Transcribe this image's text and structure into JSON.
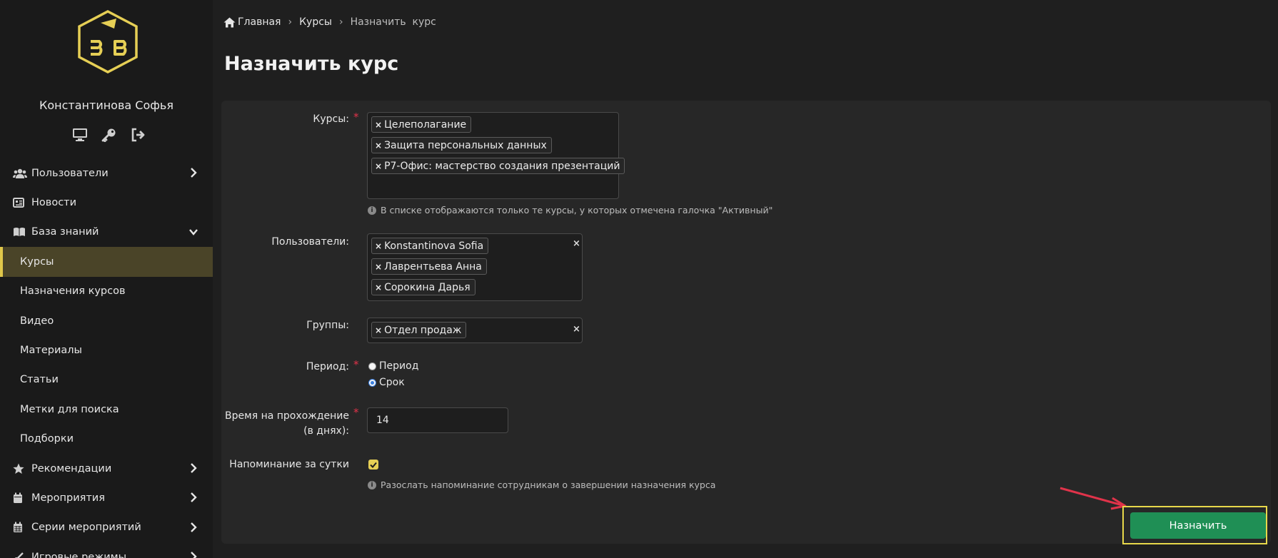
{
  "user": {
    "name": "Константинова Софья"
  },
  "sidebar": {
    "items": [
      {
        "label": "Пользователи",
        "icon": "users-icon",
        "chevron": "right"
      },
      {
        "label": "Новости",
        "icon": "newspaper-icon"
      },
      {
        "label": "База знаний",
        "icon": "book-icon",
        "chevron": "down"
      },
      {
        "label": "Курсы",
        "active": true
      },
      {
        "label": "Назначения курсов"
      },
      {
        "label": "Видео"
      },
      {
        "label": "Материалы"
      },
      {
        "label": "Статьи"
      },
      {
        "label": "Метки для поиска"
      },
      {
        "label": "Подборки"
      },
      {
        "label": "Рекомендации",
        "icon": "star-icon",
        "chevron": "right"
      },
      {
        "label": "Мероприятия",
        "icon": "calendar-icon",
        "chevron": "right"
      },
      {
        "label": "Серии мероприятий",
        "icon": "calendar-grid-icon",
        "chevron": "right"
      },
      {
        "label": "Игровые режимы",
        "icon": "game-icon",
        "chevron": "right"
      }
    ]
  },
  "breadcrumb": {
    "home": "Главная",
    "courses": "Курсы",
    "current": "Назначить  курс"
  },
  "page": {
    "title": "Назначить курс"
  },
  "form": {
    "courses": {
      "label": "Курсы:",
      "tags": [
        "Целеполагание",
        "Защита персональных данных",
        "Р7-Офис: мастерство создания презентаций"
      ],
      "help": "В списке отображаются только те курсы, у которых отмечена галочка \"Активный\""
    },
    "users": {
      "label": "Пользователи:",
      "tags": [
        "Konstantinova Sofia",
        "Лаврентьева Анна",
        "Сорокина Дарья"
      ]
    },
    "groups": {
      "label": "Группы:",
      "tags": [
        "Отдел продаж"
      ]
    },
    "period": {
      "label": "Период:",
      "options": [
        {
          "label": "Период",
          "selected": false
        },
        {
          "label": "Срок",
          "selected": true
        }
      ]
    },
    "duration": {
      "label_line1": "Время на прохождение",
      "label_line2": "(в днях):",
      "value": "14"
    },
    "reminder": {
      "label": "Напоминание за сутки",
      "checked": true,
      "help": "Разослать напоминание сотрудникам о завершении назначения курса"
    },
    "submit_label": "Назначить",
    "tag_remove_symbol": "×"
  },
  "colors": {
    "accent": "#e6cf55",
    "submit": "#1f8f55",
    "required": "#e0334a",
    "highlight": "#e8d84a",
    "arrow": "#e0334a"
  }
}
